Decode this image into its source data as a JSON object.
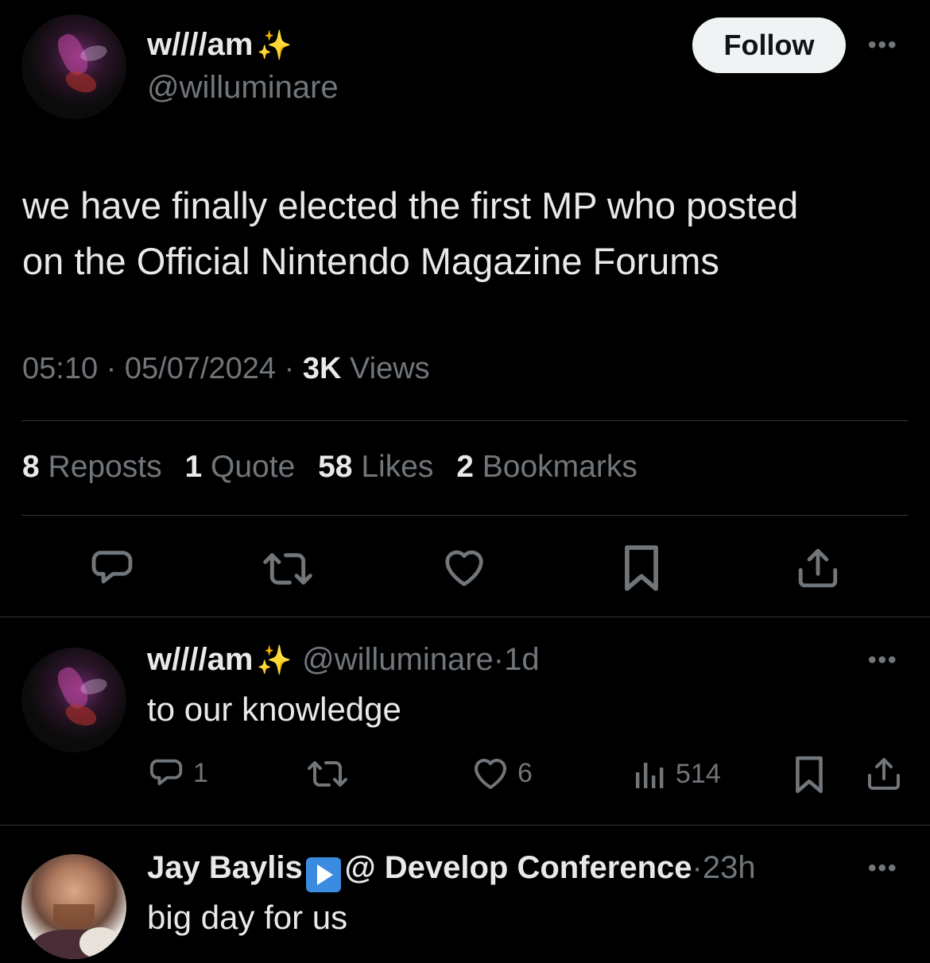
{
  "main_tweet": {
    "author_name": "w////am",
    "author_emoji": "✨",
    "author_handle": "@willuminare",
    "follow_label": "Follow",
    "more_label": "•••",
    "text_line1": "we have finally elected the first MP who posted",
    "text_line2": "on the Official Nintendo Magazine Forums",
    "time": "05:10",
    "date": "05/07/2024",
    "views_count": "3K",
    "views_label": "Views",
    "sep": "·",
    "stats": {
      "reposts_count": "8",
      "reposts_label": "Reposts",
      "quotes_count": "1",
      "quotes_label": "Quote",
      "likes_count": "58",
      "likes_label": "Likes",
      "bookmarks_count": "2",
      "bookmarks_label": "Bookmarks"
    },
    "actions": [
      "reply-icon",
      "repost-icon",
      "like-icon",
      "bookmark-icon",
      "share-icon"
    ]
  },
  "replies": [
    {
      "author_name": "w////am",
      "author_emoji": "✨",
      "author_handle": "@willuminare",
      "time_ago": "1d",
      "sep": "·",
      "more_label": "•••",
      "text": "to our knowledge",
      "reply_count": "1",
      "repost_count": "",
      "like_count": "6",
      "views_count": "514"
    },
    {
      "author_name": "Jay Baylis",
      "author_handle": "@ Develop Conference",
      "time_ago": "23h",
      "sep": "·",
      "more_label": "•••",
      "text": "big day for us"
    }
  ],
  "colors": {
    "background": "#000000",
    "text_primary": "#e7e9ea",
    "text_secondary": "#71767b",
    "divider": "#2f3336",
    "follow_bg": "#eff3f4",
    "sparkle": "#f6c844",
    "badge_blue": "#3b8be0"
  }
}
